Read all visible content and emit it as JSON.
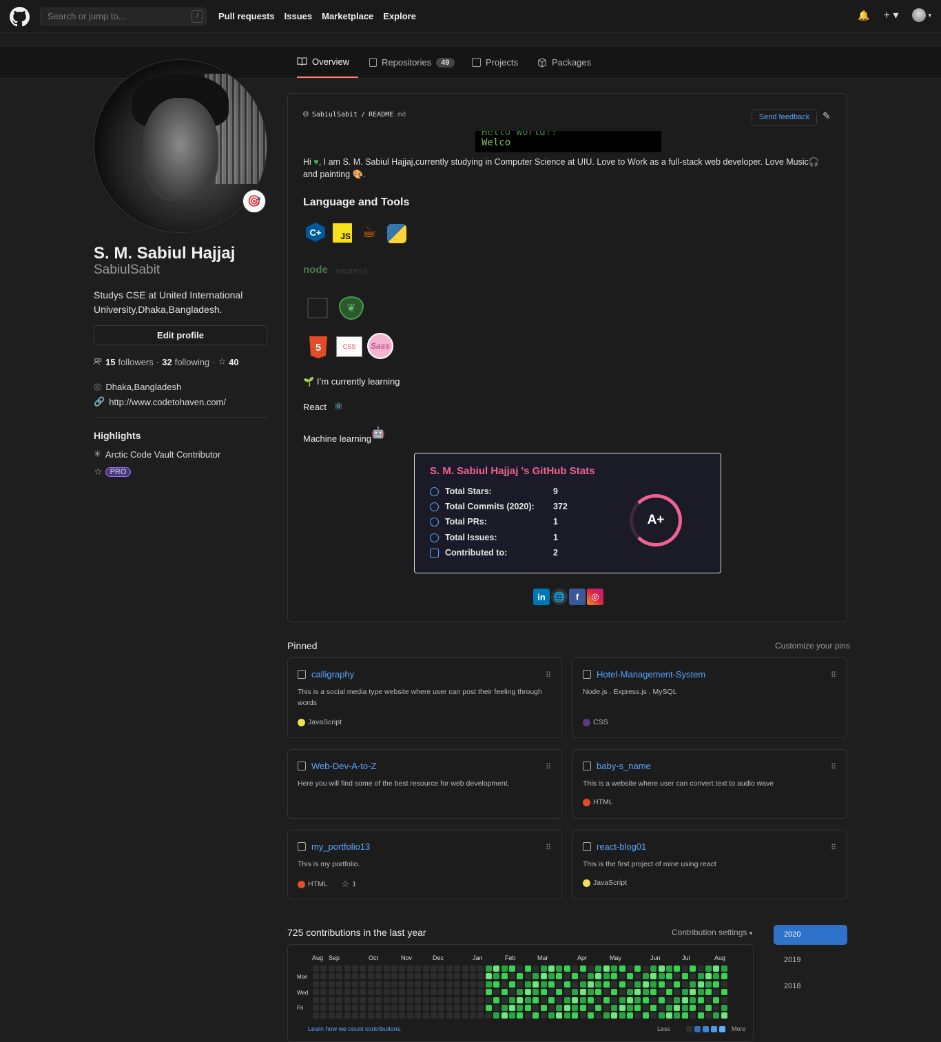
{
  "header": {
    "search_placeholder": "Search or jump to...",
    "slash": "/",
    "nav": [
      "Pull requests",
      "Issues",
      "Marketplace",
      "Explore"
    ]
  },
  "tabs": [
    {
      "label": "Overview",
      "icon": "book-icon"
    },
    {
      "label": "Repositories",
      "count": "49",
      "icon": "repo-icon"
    },
    {
      "label": "Projects",
      "icon": "project-icon"
    },
    {
      "label": "Packages",
      "icon": "package-icon"
    }
  ],
  "profile": {
    "fullname": "S. M. Sabiul Hajjaj",
    "username": "SabiulSabit",
    "bio": "Studys CSE at United International University,Dhaka,Bangladesh.",
    "edit_label": "Edit profile",
    "followers": "15",
    "followers_label": "followers",
    "following": "32",
    "following_label": "following",
    "stars": "40",
    "location": "Dhaka,Bangladesh",
    "website": "http://www.codetohaven.com/",
    "highlights_title": "Highlights",
    "highlight_item": "Arctic Code Vault Contributor",
    "pro": "PRO"
  },
  "readme": {
    "owner": "SabiulSabit",
    "sep": "/",
    "file": "README",
    "ext": ".md",
    "feedback_label": "Send feedback",
    "terminal_l1": "Hello World!!",
    "terminal_l2": "Welco",
    "intro_1": "Hi",
    "intro_2": ", I am S. M. Sabiul Hajjaj,currently studying in Computer Science at UIU. Love to Work as a full-stack web developer. Love Music",
    "intro_3": "and painting",
    "lang_title": "Language and Tools",
    "learning": "I’m currently learning",
    "react": "React",
    "ml": "Machine learning",
    "node": "node",
    "express": "express",
    "js": "JS",
    "css": "CSS",
    "sass": "Sass",
    "html5": "5"
  },
  "stats": {
    "title": "S. M. Sabiul Hajjaj 's GitHub Stats",
    "rows": [
      {
        "label": "Total Stars:",
        "value": "9"
      },
      {
        "label": "Total Commits (2020):",
        "value": "372"
      },
      {
        "label": "Total PRs:",
        "value": "1"
      },
      {
        "label": "Total Issues:",
        "value": "1"
      },
      {
        "label": "Contributed to:",
        "value": "2"
      }
    ],
    "grade": "A+"
  },
  "socials": [
    "in",
    "f"
  ],
  "pinned": {
    "title": "Pinned",
    "customize": "Customize your pins",
    "items": [
      {
        "name": "calligraphy",
        "desc": "This is a social media type website where user can post their feeling through words",
        "lang": "JavaScript",
        "color": "#f1e05a"
      },
      {
        "name": "Hotel-Management-System",
        "desc": "Node.js . Express.js . MySQL",
        "lang": "CSS",
        "color": "#563d7c"
      },
      {
        "name": "Web-Dev-A-to-Z",
        "desc": "Here you will find some of the best resource for web development.",
        "lang": "",
        "color": ""
      },
      {
        "name": "baby-s_name",
        "desc": "This is a website where user can convert text to audio wave",
        "lang": "HTML",
        "color": "#e34c26"
      },
      {
        "name": "my_portfolio13",
        "desc": "This is my portfolio.",
        "lang": "HTML",
        "color": "#e34c26",
        "stars": "1"
      },
      {
        "name": "react-blog01",
        "desc": "This is the first project of mine using react",
        "lang": "JavaScript",
        "color": "#f1e05a"
      }
    ]
  },
  "contrib": {
    "title": "725 contributions in the last year",
    "settings": "Contribution settings",
    "months": [
      "Aug",
      "Sep",
      "Oct",
      "Nov",
      "Dec",
      "Jan",
      "Feb",
      "Mar",
      "Apr",
      "May",
      "Jun",
      "Jul",
      "Aug"
    ],
    "days": [
      "Mon",
      "Wed",
      "Fri"
    ],
    "learn": "Learn how we count contributions.",
    "less": "Less",
    "more": "More",
    "years": [
      "2020",
      "2019",
      "2018"
    ]
  }
}
